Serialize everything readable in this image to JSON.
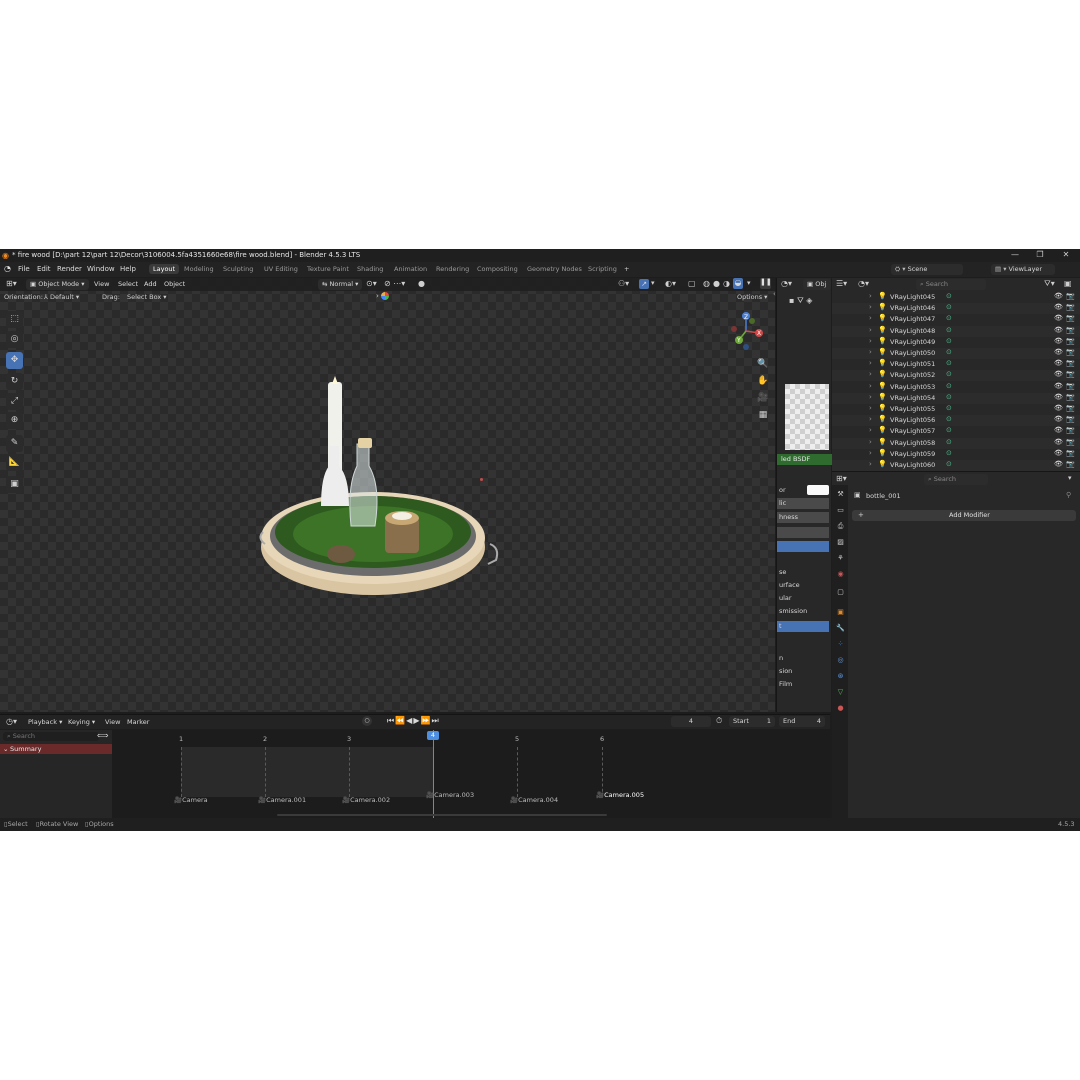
{
  "window": {
    "title": "* fire wood [D:\\part 12\\part 12\\Decor\\3106004.5fa4351660e68\\fire wood.blend] - Blender 4.5.3 LTS",
    "controls": [
      "—",
      "❐",
      "✕"
    ]
  },
  "menubar": {
    "items": [
      "File",
      "Edit",
      "Render",
      "Window",
      "Help"
    ],
    "workspaces": [
      "Layout",
      "Modeling",
      "Sculpting",
      "UV Editing",
      "Texture Paint",
      "Shading",
      "Animation",
      "Rendering",
      "Compositing",
      "Geometry Nodes",
      "Scripting"
    ],
    "active_workspace": "Layout",
    "add_tab": "+",
    "scene": "Scene",
    "view_layer": "ViewLayer"
  },
  "viewport": {
    "mode": "Object Mode",
    "menus": [
      "View",
      "Select",
      "Add",
      "Object"
    ],
    "orientation_label": "Orientation:",
    "orientation_value": "Default",
    "drag_label": "Drag:",
    "drag_value": "Select Box",
    "transform_orientation": "Normal",
    "options_label": "Options",
    "gizmo": {
      "x": "X",
      "y": "Y",
      "z": "Z"
    }
  },
  "material_strip": {
    "header": "Obj",
    "shader": "led BSDF",
    "labels": [
      "or",
      "lic",
      "hness",
      "se",
      "urface",
      "ular",
      "smission",
      "t",
      "n",
      "sion",
      "Film"
    ]
  },
  "outliner": {
    "search_placeholder": "Search",
    "items": [
      "VRayLight045",
      "VRayLight046",
      "VRayLight047",
      "VRayLight048",
      "VRayLight049",
      "VRayLight050",
      "VRayLight051",
      "VRayLight052",
      "VRayLight053",
      "VRayLight054",
      "VRayLight055",
      "VRayLight056",
      "VRayLight057",
      "VRayLight058",
      "VRayLight059",
      "VRayLight060"
    ]
  },
  "properties": {
    "search_placeholder": "Search",
    "object_name": "bottle_001",
    "add_modifier": "Add Modifier"
  },
  "timeline": {
    "menus": [
      "Playback",
      "Keying",
      "View",
      "Marker"
    ],
    "current_frame": "4",
    "start_label": "Start",
    "start_value": "1",
    "end_label": "End",
    "end_value": "4",
    "search_placeholder": "Search",
    "summary": "Summary",
    "frames": [
      "1",
      "2",
      "3",
      "4",
      "5",
      "6"
    ],
    "markers": [
      "Camera",
      "Camera.001",
      "Camera.002",
      "Camera.003",
      "Camera.004",
      "Camera.005"
    ]
  },
  "statusbar": {
    "hints": [
      "Select",
      "Rotate View",
      "Options"
    ],
    "version": "4.5.3"
  },
  "colors": {
    "accent": "#4772b3",
    "summary": "#6b2a2a",
    "shader_header": "#2f6b2f",
    "playhead": "#4e8fe0"
  }
}
